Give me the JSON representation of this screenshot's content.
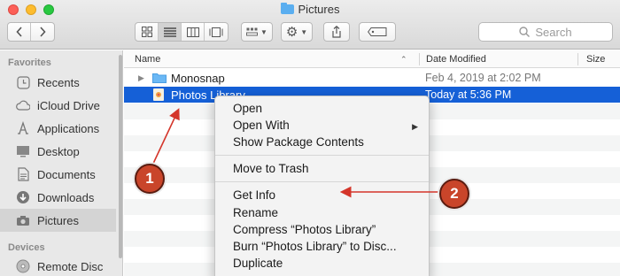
{
  "window": {
    "title": "Pictures"
  },
  "toolbar": {
    "search_placeholder": "Search"
  },
  "sidebar": {
    "favorites_label": "Favorites",
    "items": [
      {
        "label": "Recents",
        "icon": "clock-icon"
      },
      {
        "label": "iCloud Drive",
        "icon": "cloud-icon"
      },
      {
        "label": "Applications",
        "icon": "applications-icon"
      },
      {
        "label": "Desktop",
        "icon": "desktop-icon"
      },
      {
        "label": "Documents",
        "icon": "document-icon"
      },
      {
        "label": "Downloads",
        "icon": "download-icon"
      },
      {
        "label": "Pictures",
        "icon": "camera-icon",
        "selected": true
      }
    ],
    "devices_label": "Devices",
    "devices": [
      {
        "label": "Remote Disc",
        "icon": "disc-icon"
      }
    ]
  },
  "columns": {
    "name": "Name",
    "date": "Date Modified",
    "size": "Size"
  },
  "files": [
    {
      "name": "Monosnap",
      "date": "Feb 4, 2019 at 2:02 PM",
      "icon": "folder-icon"
    },
    {
      "name": "Photos Library",
      "date": "Today at 5:36 PM",
      "icon": "photos-library-icon",
      "selected": true
    }
  ],
  "context_menu": {
    "items": [
      "Open",
      "Open With",
      "Show Package Contents",
      "Move to Trash",
      "Get Info",
      "Rename",
      "Compress “Photos Library”",
      "Burn “Photos Library” to Disc...",
      "Duplicate"
    ]
  },
  "annotations": {
    "badge1": "1",
    "badge2": "2",
    "color": "#c9452a"
  }
}
